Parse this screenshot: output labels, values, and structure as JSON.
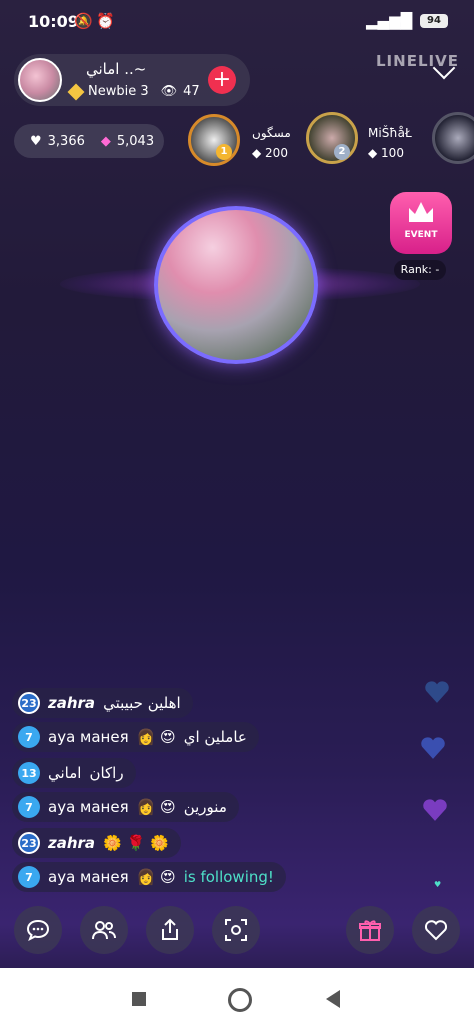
{
  "status": {
    "time": "10:09",
    "battery": "94"
  },
  "host": {
    "name": "اماني ..~",
    "rank": "Newbie 3",
    "viewers": "47"
  },
  "watermark": "LINELIVE",
  "stats": {
    "hearts": "3,366",
    "gems": "5,043"
  },
  "rankers": [
    {
      "name": "مسگوں",
      "score": "200",
      "badge": "1"
    },
    {
      "name": "MiŠħåŁ",
      "score": "100",
      "badge": "2"
    }
  ],
  "event": {
    "label": "EVENT",
    "rank": "Rank: -"
  },
  "chat": [
    {
      "level": "23",
      "user": "zahra",
      "text": "اهلين حبيبتي"
    },
    {
      "level": "7",
      "user": "aya манея",
      "text": "عاملين اي"
    },
    {
      "level": "13",
      "user": "اماني",
      "text": "راكان"
    },
    {
      "level": "7",
      "user": "aya манея",
      "text": "منورين"
    },
    {
      "level": "23",
      "user": "zahra",
      "text": ""
    },
    {
      "level": "7",
      "user": "aya манея",
      "text": "is following!"
    }
  ],
  "colors": {
    "accent": "#f03050",
    "follow": "#4ee0c8",
    "level": "#3aa8f0"
  }
}
